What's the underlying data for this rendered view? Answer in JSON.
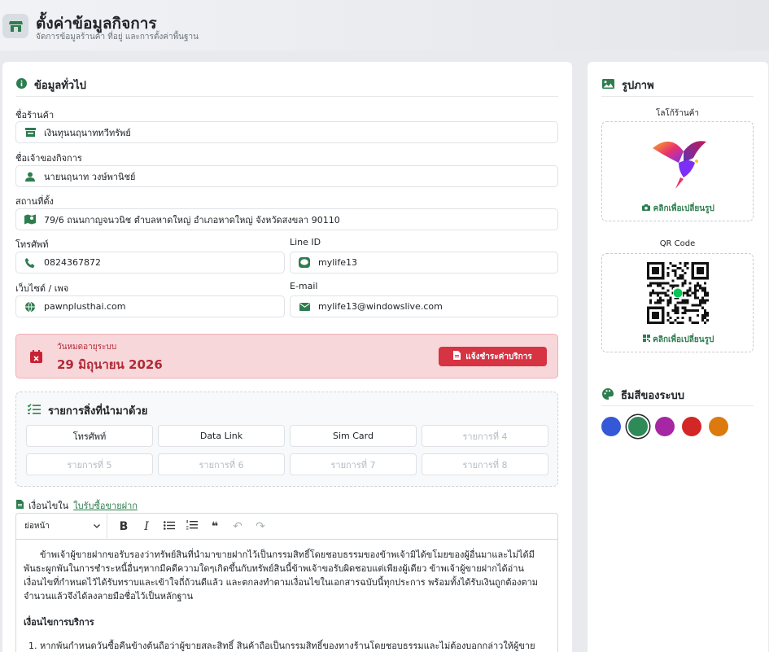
{
  "header": {
    "title": "ตั้งค่าข้อมูลกิจการ",
    "subtitle": "จัดการข้อมูลร้านค้า ที่อยู่ และการตั้งค่าพื้นฐาน"
  },
  "general": {
    "title": "ข้อมูลทั่วไป",
    "shop_name": {
      "label": "ชื่อร้านค้า",
      "value": "เงินทุนนฤนาททวีทรัพย์"
    },
    "owner": {
      "label": "ชื่อเจ้าของกิจการ",
      "value": "นายนฤนาท วงษ์พานิชย์"
    },
    "address": {
      "label": "สถานที่ตั้ง",
      "value": "79/6 ถนนกาญจนวนิช ตำบลหาดใหญ่ อำเภอหาดใหญ่ จังหวัดสงขลา 90110"
    },
    "phone": {
      "label": "โทรศัพท์",
      "value": "0824367872"
    },
    "line": {
      "label": "Line ID",
      "value": "mylife13"
    },
    "website": {
      "label": "เว็บไซต์ / เพจ",
      "value": "pawnplusthai.com"
    },
    "email": {
      "label": "E-mail",
      "value": "mylife13@windowslive.com"
    }
  },
  "expiry": {
    "label": "วันหมดอายุระบบ",
    "date": "29 มิถุนายน 2026",
    "pay_button": "แจ้งชำระค่าบริการ"
  },
  "items": {
    "title": "รายการสิ่งที่นำมาด้วย",
    "list": [
      "โทรศัพท์",
      "Data Link",
      "Sim Card",
      "รายการที่ 4",
      "รายการที่ 5",
      "รายการที่ 6",
      "รายการที่ 7",
      "รายการที่ 8"
    ],
    "filled": [
      true,
      true,
      true,
      false,
      false,
      false,
      false,
      false
    ]
  },
  "terms": {
    "label_prefix": "เงื่อนไขใน",
    "label_link": "ใบรับซื้อขายฝาก",
    "toolbar": {
      "style_select": "ย่อหน้า",
      "bold": "B",
      "italic": "I",
      "quote": "❝",
      "undo": "↶",
      "redo": "↷"
    },
    "paragraph": "ข้าพเจ้าผู้ขายฝากขอรับรองว่าทรัพย์สินที่นำมาขายฝากไว้เป็นกรรมสิทธิ์โดยชอบธรรมของข้าพเจ้ามิได้ขโมยของผู้อื่นมาและไม่ได้มีพันธะผูกพันในการชำระหนี้อื่นๆหากมีคดีความใดๆเกิดขึ้นกับทรัพย์สินนี้ข้าพเจ้าขอรับผิดชอบแต่เพียงผู้เดียว ข้าพเจ้าผู้ขายฝากได้อ่านเงื่อนไขที่กำหนดไว้ได้รับทราบและเข้าใจถี่ถ้วนดีแล้ว และตกลงทำตามเงื่อนไขในเอกสารฉบับนี้ทุกประการ พร้อมทั้งได้รับเงินถูกต้องตามจำนวนแล้วจึงได้ลงลายมือชื่อไว้เป็นหลักฐาน",
    "heading": "เงื่อนไขการบริการ",
    "list_item_1": "หากพ้นกำหนดวันซื้อคืนข้างต้นถือว่าผู้ขายสละสิทธิ์ สินค้าถือเป็นกรรมสิทธิ์ของทางร้านโดยชอบธรรมและไม่ต้องบอกกล่าวให้ผู้ขายฝากรับทราบอีก"
  },
  "images": {
    "title": "รูปภาพ",
    "logo_label": "โลโก้ร้านค้า",
    "logo_change": "คลิกเพื่อเปลี่ยนรูป",
    "qr_label": "QR Code",
    "qr_change": "คลิกเพื่อเปลี่ยนรูป"
  },
  "theme": {
    "title": "ธีมสีของระบบ",
    "colors": [
      "#3558d6",
      "#2e8b57",
      "#a626a4",
      "#d32626",
      "#dd7a0d"
    ],
    "selected": 1
  },
  "accent_color": "#2e7d4f"
}
